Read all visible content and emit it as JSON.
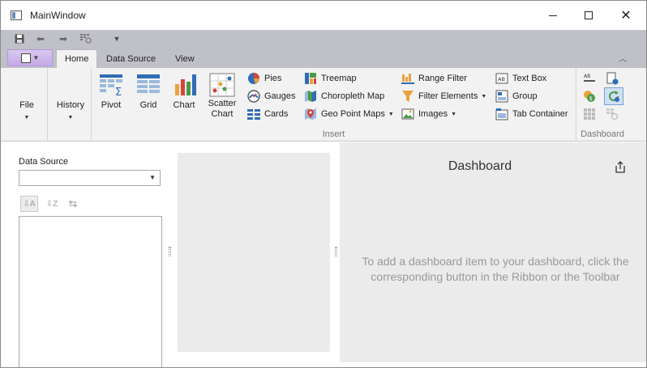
{
  "window": {
    "title": "MainWindow"
  },
  "qat": {
    "items": [
      "save-icon",
      "undo-icon",
      "redo-icon",
      "refresh-icon",
      "customize-icon"
    ]
  },
  "tabs": [
    {
      "label": "Home",
      "active": true
    },
    {
      "label": "Data Source",
      "active": false
    },
    {
      "label": "View",
      "active": false
    }
  ],
  "ribbon": {
    "file": {
      "label": "File"
    },
    "history": {
      "label": "History"
    },
    "insert": {
      "caption": "Insert",
      "pivot": "Pivot",
      "grid": "Grid",
      "chart": "Chart",
      "scatter_line1": "Scatter",
      "scatter_line2": "Chart",
      "pies": "Pies",
      "gauges": "Gauges",
      "cards": "Cards",
      "treemap": "Treemap",
      "choropleth": "Choropleth Map",
      "geopoint": "Geo Point Maps",
      "range_filter": "Range Filter",
      "filter_elements": "Filter Elements",
      "images": "Images",
      "text_box": "Text Box",
      "group": "Group",
      "tab_container": "Tab Container"
    },
    "dashboard": {
      "caption": "Dashboard"
    }
  },
  "data_source_panel": {
    "label": "Data Source",
    "combo_value": ""
  },
  "dashboard": {
    "title": "Dashboard",
    "hint_line1": "To add a dashboard item to your dashboard, click the",
    "hint_line2": "corresponding button in the Ribbon or the Toolbar"
  },
  "colors": {
    "accent_blue": "#2f6db5",
    "qat_bg": "#c0c0c8",
    "ribbon_bg": "#f2f2f2",
    "canvas_bg": "#ebebeb",
    "app_menu": "#c5a9e6"
  }
}
